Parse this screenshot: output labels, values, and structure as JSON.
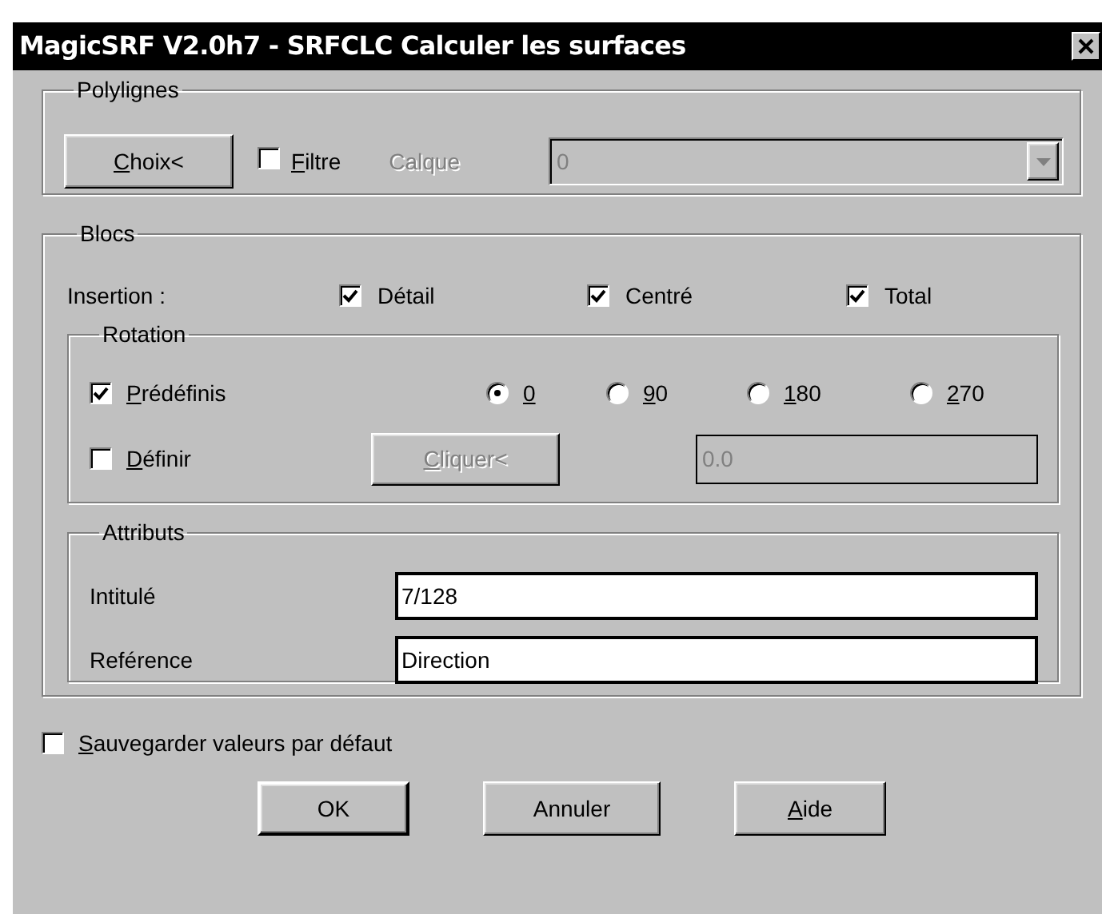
{
  "window": {
    "title": "MagicSRF V2.0h7 - SRFCLC Calculer les surfaces"
  },
  "polylines": {
    "title": "Polylignes",
    "choose_button": {
      "label": "Choix<",
      "underline_first": true
    },
    "filter": {
      "label": "Filtre",
      "underline_first": true,
      "checked": false
    },
    "layer_label": {
      "label": "Calque",
      "disabled": true
    },
    "layer_combo": {
      "value": "0",
      "disabled": true
    }
  },
  "blocks": {
    "title": "Blocs",
    "insertion_label": "Insertion :",
    "insertion_options": [
      {
        "label": "Détail",
        "checked": true
      },
      {
        "label": "Centré",
        "checked": true
      },
      {
        "label": "Total",
        "checked": true
      }
    ],
    "rotation": {
      "title": "Rotation",
      "predefined": {
        "label": "Prédéfinis",
        "underline_first": true,
        "checked": true
      },
      "angles": [
        {
          "label": "0",
          "underline_first": true,
          "selected": true
        },
        {
          "label": "90",
          "underline_first": true,
          "selected": false
        },
        {
          "label": "180",
          "underline_first": true,
          "selected": false
        },
        {
          "label": "270",
          "underline_first": true,
          "selected": false
        }
      ],
      "define": {
        "label": "Définir",
        "underline_first": true,
        "checked": false
      },
      "click_button": {
        "label": "Cliquer<",
        "underline_first": true,
        "disabled": true
      },
      "angle_field": {
        "value": "0.0",
        "disabled": true
      }
    },
    "attributes": {
      "title": "Attributs",
      "fields": [
        {
          "label": "Intitulé",
          "value": "7/128"
        },
        {
          "label": "Reférence",
          "value": "Direction"
        }
      ]
    }
  },
  "save_defaults": {
    "label": "Sauvegarder valeurs par défaut",
    "underline_first": true,
    "checked": false
  },
  "buttons": [
    {
      "label": "OK",
      "underline_first": false,
      "default": true
    },
    {
      "label": "Annuler",
      "underline_first": false,
      "default": false
    },
    {
      "label": "Aide",
      "underline_first": true,
      "default": false
    }
  ]
}
